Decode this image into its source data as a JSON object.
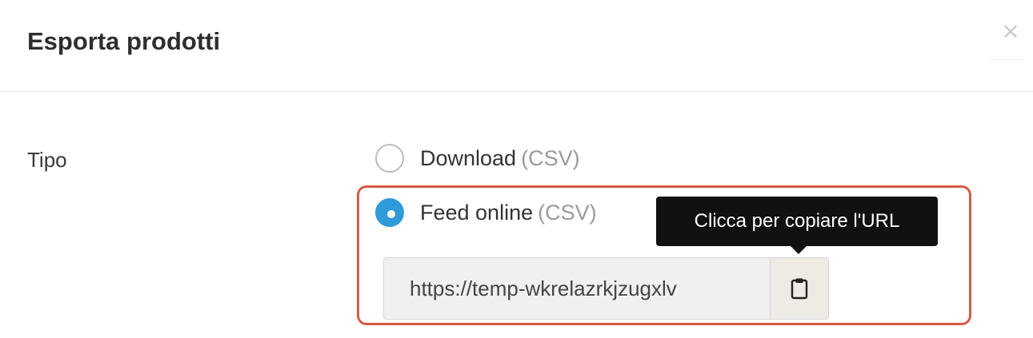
{
  "modal": {
    "title": "Esporta prodotti",
    "close_label": "×"
  },
  "form": {
    "type_label": "Tipo",
    "options": [
      {
        "label": "Download",
        "hint": "(CSV)",
        "selected": false
      },
      {
        "label": "Feed online",
        "hint": "(CSV)",
        "selected": true
      }
    ],
    "feed_url": "https://temp-wkrelazrkjzugxlv",
    "copy_icon": "clipboard-icon",
    "tooltip": "Clicca per copiare l'URL"
  },
  "colors": {
    "accent": "#2f9bd8",
    "highlight": "#d85a41",
    "tooltip_bg": "#111111"
  }
}
